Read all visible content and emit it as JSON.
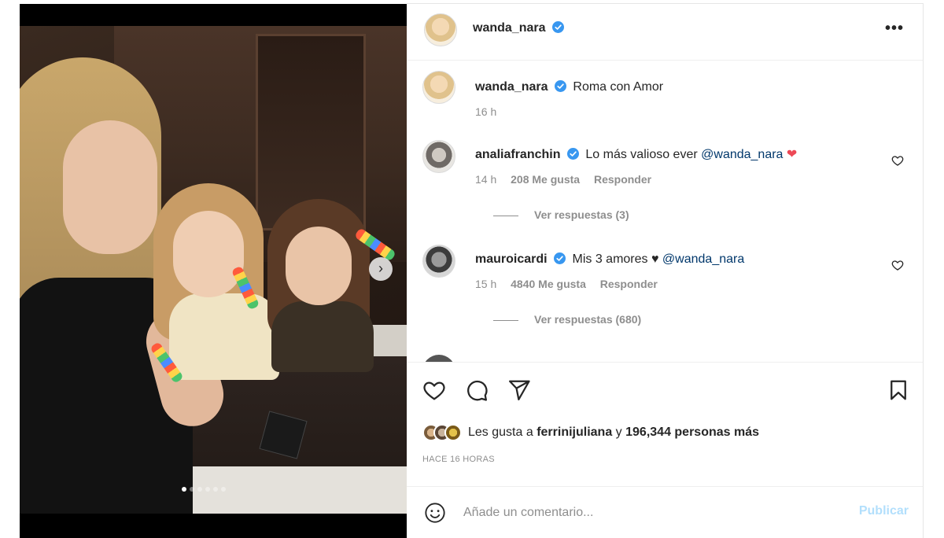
{
  "post": {
    "author": "wanda_nara",
    "caption_author": "wanda_nara",
    "caption": "Roma con Amor",
    "caption_time": "16 h",
    "carousel": {
      "total_slides": 6,
      "active_slide": 1
    }
  },
  "comments": [
    {
      "user": "analiafranchin",
      "text": "Lo más valioso ever",
      "mention": "@wanda_nara",
      "emoji": "❤",
      "time": "14 h",
      "likes": "208 Me gusta",
      "reply_label": "Responder",
      "view_replies": "Ver respuestas (3)"
    },
    {
      "user": "mauroicardi",
      "text": "Mis 3 amores ♥",
      "mention": "@wanda_nara",
      "time": "15 h",
      "likes": "4840 Me gusta",
      "reply_label": "Responder",
      "view_replies": "Ver respuestas (680)"
    }
  ],
  "engagement": {
    "likes_prefix": "Les gusta a",
    "liked_by": "ferrinijuliana",
    "likes_joiner": "y",
    "likes_count": "196,344 personas más",
    "posted_ago": "HACE 16 HORAS"
  },
  "comment_box": {
    "placeholder": "Añade un comentario...",
    "publish_label": "Publicar"
  },
  "icons": {
    "more": "more-options-icon",
    "verified": "verified-badge-icon",
    "like": "heart-icon",
    "comment": "comment-icon",
    "share": "paper-plane-icon",
    "save": "bookmark-icon",
    "emoji": "emoji-icon",
    "next": "chevron-right-icon"
  },
  "colors": {
    "verified": "#3897f0",
    "link": "#00376b",
    "muted": "#8e8e8e",
    "publish_disabled": "#b2dffc",
    "heart": "#ed4956"
  }
}
